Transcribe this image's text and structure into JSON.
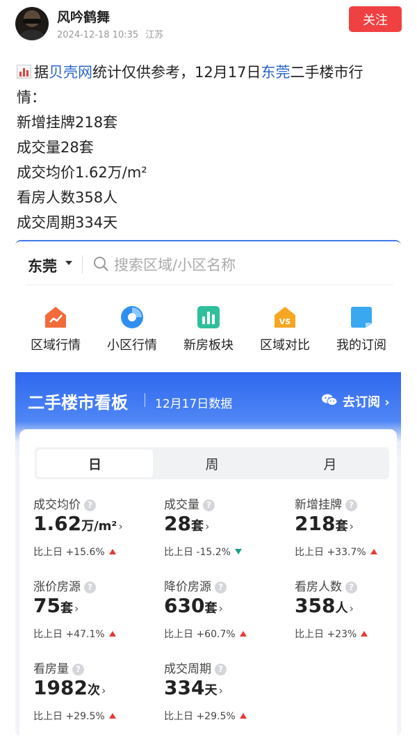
{
  "header": {
    "username": "风吟鹤舞",
    "datetime": "2024-12-18 10:35",
    "location": "江苏",
    "follow_label": "关注"
  },
  "post": {
    "line1_prefix": "据",
    "line1_link1": "贝壳网",
    "line1_mid": "统计仅供参考，12月17日",
    "line1_link2": "东莞",
    "line1_suffix": "二手楼市行",
    "line2": "情：",
    "line3": "新增挂牌218套",
    "line4": "成交量28套",
    "line5": "成交均价1.62万/m²",
    "line6": "看房人数358人",
    "line7": "成交周期334天"
  },
  "app": {
    "city": "东莞",
    "search_placeholder": "搜索区域/小区名称",
    "nav": [
      {
        "label": "区域行情",
        "icon": "area-trend-icon",
        "color": "#f26b3a"
      },
      {
        "label": "小区行情",
        "icon": "community-pie-icon",
        "color": "#2f8ff0"
      },
      {
        "label": "新房板块",
        "icon": "new-house-bar-icon",
        "color": "#2fbf9b"
      },
      {
        "label": "区域对比",
        "icon": "vs-compare-icon",
        "color": "#f5a623"
      },
      {
        "label": "我的订阅",
        "icon": "subscription-icon",
        "color": "#3aa8f0"
      }
    ],
    "board": {
      "title": "二手楼市看板",
      "date": "12月17日数据",
      "subscribe": "去订阅 ›",
      "tabs": [
        "日",
        "周",
        "月"
      ],
      "metrics": [
        {
          "label": "成交均价",
          "num": "1.62",
          "unit": "万/m²",
          "change": "比上日 +15.6%",
          "trend": "up"
        },
        {
          "label": "成交量",
          "num": "28",
          "unit": "套",
          "change": "比上日 -15.2%",
          "trend": "down"
        },
        {
          "label": "新增挂牌",
          "num": "218",
          "unit": "套",
          "change": "比上日 +33.7%",
          "trend": "up"
        },
        {
          "label": "涨价房源",
          "num": "75",
          "unit": "套",
          "change": "比上日 +47.1%",
          "trend": "up"
        },
        {
          "label": "降价房源",
          "num": "630",
          "unit": "套",
          "change": "比上日 +60.7%",
          "trend": "up"
        },
        {
          "label": "看房人数",
          "num": "358",
          "unit": "人",
          "change": "比上日 +23%",
          "trend": "up"
        },
        {
          "label": "看房量",
          "num": "1982",
          "unit": "次",
          "change": "比上日 +29.5%",
          "trend": "up"
        },
        {
          "label": "成交周期",
          "num": "334",
          "unit": "天",
          "change": "比上日 +29.5%",
          "trend": "up"
        }
      ]
    }
  },
  "colors": {
    "follow_button": "#f04142",
    "link": "#2a64c8",
    "board_blue": "#2f68f0",
    "up": "#e53935",
    "down": "#16a085"
  }
}
